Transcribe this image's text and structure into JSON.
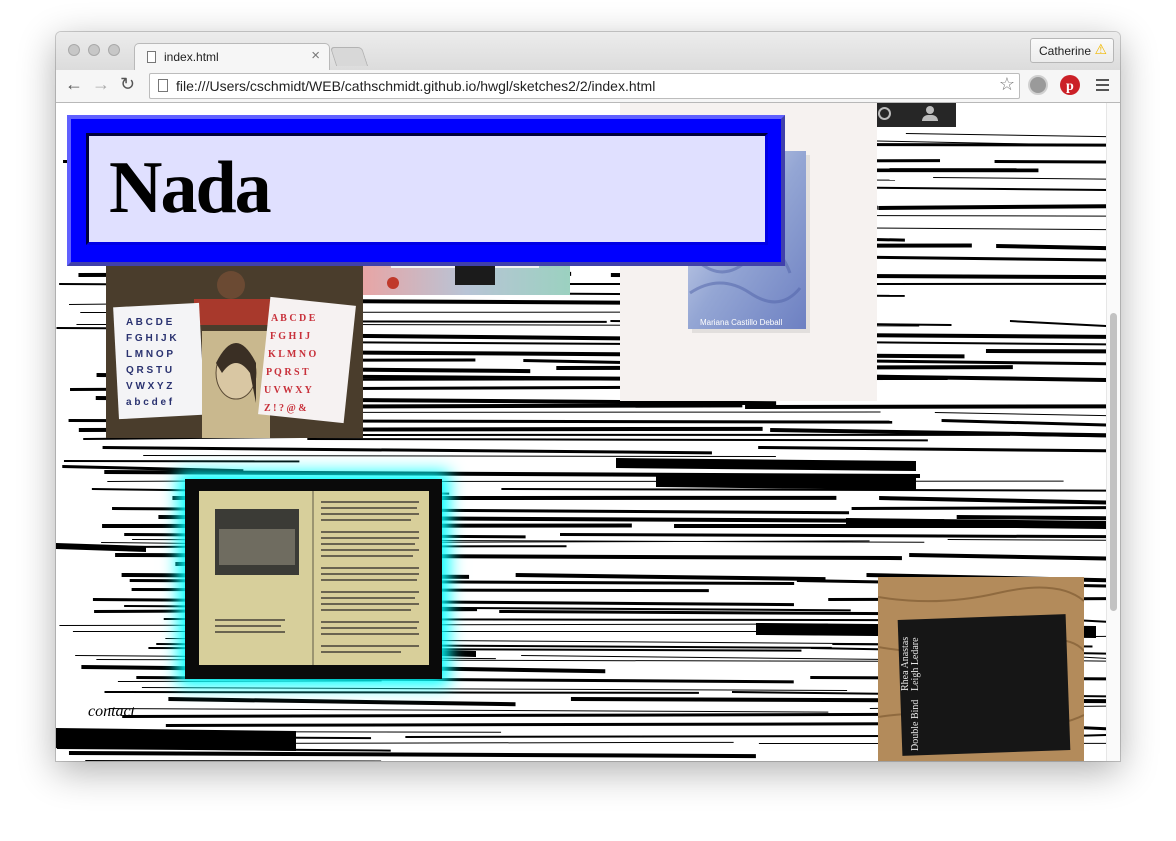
{
  "browser": {
    "tab_title": "index.html",
    "tab_close": "×",
    "profile_name": "Catherine",
    "profile_warning_glyph": "⚠",
    "url": "file:///Users/cschmidt/WEB/cathschmidt.github.io/hwgl/sketches2/2/index.html",
    "back_glyph": "←",
    "forward_glyph": "→",
    "reload_glyph": "↻",
    "star_glyph": "☆",
    "extensions": [
      "download-icon",
      "pinterest-icon"
    ],
    "pinterest_color": "#cb2027"
  },
  "page": {
    "title": "Nada",
    "contact": "contact",
    "frame_color": "#0000ff",
    "glow_color": "#00ffff",
    "images": [
      {
        "name": "alphabet-posters-photo",
        "description": "Two people holding hand-drawn alphabet posters"
      },
      {
        "name": "open-book-photo",
        "description": "Open book with letter A on spread"
      },
      {
        "name": "blue-book-photo",
        "description": "Blue marbled book cover"
      },
      {
        "name": "book-spread-photo",
        "description": "Open book spread with photograph and text"
      },
      {
        "name": "double-bind-book-photo",
        "description": "Black book on wooden table"
      }
    ],
    "double_bind": {
      "title": "Double Bind",
      "authors": [
        "Rhea Anastas",
        "Leigh Ledare"
      ]
    },
    "blue_book_text": "Mariana Castillo Deball"
  }
}
